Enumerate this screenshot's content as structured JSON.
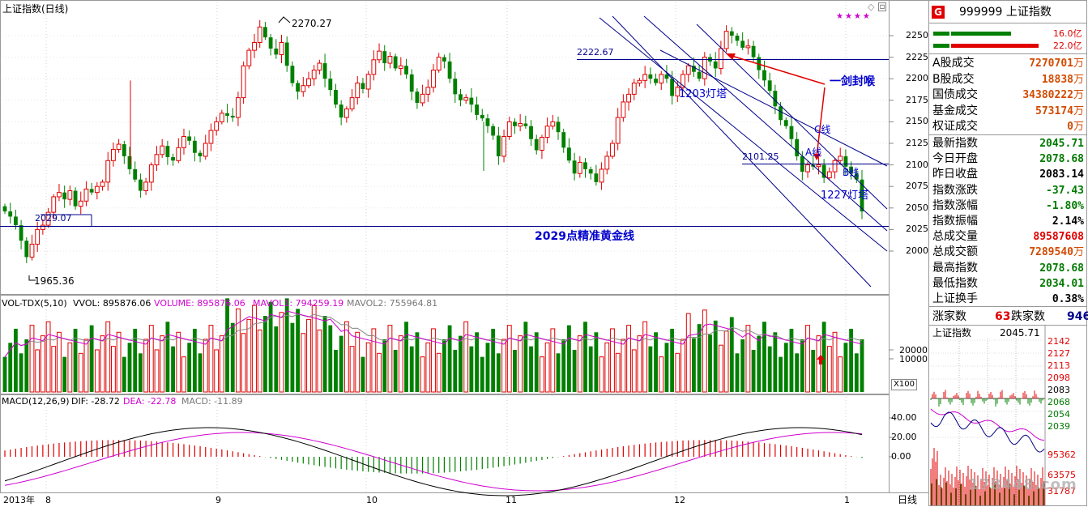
{
  "main_chart": {
    "title": "上证指数(日线)",
    "stars": "★★★★",
    "price_axis": [
      "2250",
      "2225",
      "2200",
      "2175",
      "2150",
      "2125",
      "2100",
      "2075",
      "2050",
      "2025",
      "2000"
    ],
    "labels": {
      "high": "2270.27",
      "low": "1965.36",
      "low_line_value": "2029.07",
      "level_2222": "2222.67",
      "level_2101": "2101.25",
      "golden_line": "2029点精准黄金线",
      "lamp_1203": "1203灯塔",
      "lamp_1227": "1227灯塔",
      "c_line": "C线",
      "a_line": "A线",
      "b_line": "B线",
      "yi_jian": "一剑封喉"
    }
  },
  "volume_panel": {
    "name": "VOL-TDX(5,10)",
    "vvol": "VVOL: 895876.06",
    "volume": "VOLUME: 895876.06",
    "mavol1": "MAVOL1: 794259.19",
    "mavol2": "MAVOL2: 755964.81",
    "axis": [
      "20000",
      "10000"
    ],
    "unit": "X100"
  },
  "macd_panel": {
    "name": "MACD(12,26,9)",
    "dif": "DIF: -28.72",
    "dea": "DEA: -22.78",
    "macd": "MACD: -11.89",
    "axis": [
      "40.00",
      "20.00",
      "0.00"
    ]
  },
  "date_axis": {
    "labels": [
      "2013年",
      "8",
      "9",
      "10",
      "11",
      "12",
      "1"
    ],
    "period": "日线"
  },
  "right_panel": {
    "badge": "G",
    "code_name": "999999 上证指数",
    "bar1_value": "16.0亿",
    "bar2_value": "22.0亿",
    "rows1": [
      {
        "label": "A股成交",
        "value": "7270701",
        "unit": "万"
      },
      {
        "label": "B股成交",
        "value": "18838",
        "unit": "万"
      },
      {
        "label": "国债成交",
        "value": "34380222",
        "unit": "万"
      },
      {
        "label": "基金成交",
        "value": "573174",
        "unit": "万"
      },
      {
        "label": "权证成交",
        "value": "0",
        "unit": "万"
      }
    ],
    "rows2": [
      {
        "label": "最新指数",
        "value": "2045.71"
      },
      {
        "label": "今日开盘",
        "value": "2078.68"
      },
      {
        "label": "昨日收盘",
        "value": "2083.14"
      },
      {
        "label": "指数涨跌",
        "value": "-37.43"
      },
      {
        "label": "指数涨幅",
        "value": "-1.80%"
      },
      {
        "label": "指数振幅",
        "value": "2.14%"
      },
      {
        "label": "总成交量",
        "value": "89587608"
      },
      {
        "label": "总成交额",
        "value": "7289540",
        "unit": "万"
      },
      {
        "label": "最高指数",
        "value": "2078.68"
      },
      {
        "label": "最低指数",
        "value": "2034.01"
      },
      {
        "label": "上证换手",
        "value": "0.38%"
      }
    ],
    "rise_label": "涨家数",
    "rise_value": "63",
    "fall_label": "跌家数",
    "fall_value": "946"
  },
  "mini_chart": {
    "title": "上证指数",
    "value": "2045.71",
    "axis": [
      "2142",
      "2127",
      "2113",
      "2098",
      "2083",
      "2068",
      "2054",
      "2039"
    ],
    "vol_labels": [
      "95362",
      "63575",
      "31787"
    ],
    "watermark": "178448.com"
  },
  "colors": {
    "up": "#e00000",
    "down": "#008000",
    "trendline": "#00008b",
    "ma1": "#d000d0",
    "ma2": "#888888"
  }
}
